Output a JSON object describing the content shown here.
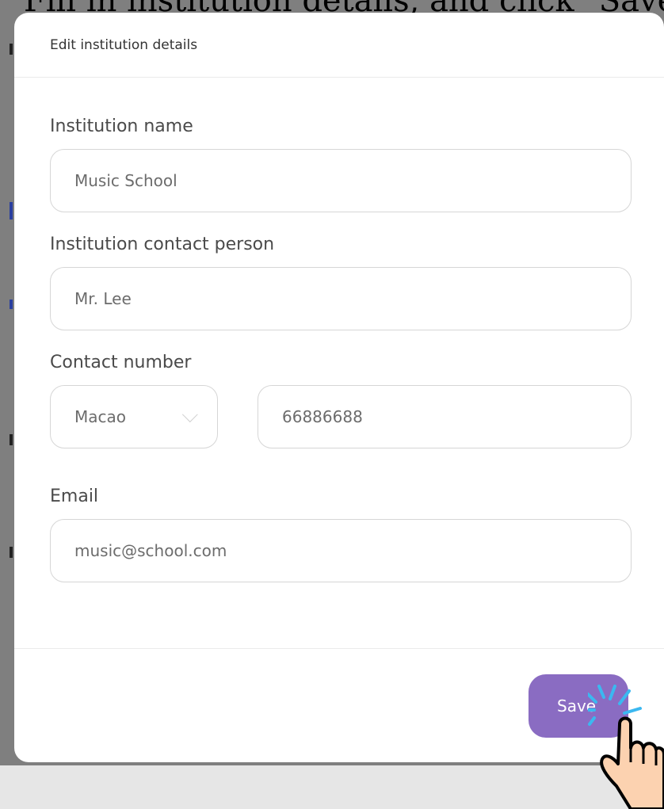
{
  "background": {
    "title_fragment": "Fill in institution details, and click \"Save\""
  },
  "modal": {
    "title": "Edit institution details",
    "fields": {
      "name": {
        "label": "Institution name",
        "value": "Music School"
      },
      "contact_person": {
        "label": "Institution contact person",
        "value": "Mr. Lee"
      },
      "contact_number": {
        "label": "Contact number",
        "region": "Macao",
        "number": "66886688"
      },
      "email": {
        "label": "Email",
        "value": "music@school.com"
      }
    },
    "save_label": "Save"
  },
  "colors": {
    "accent": "#8a6cc2",
    "overlay": "#7f7f7f",
    "click_effect": "#3bb8f0"
  },
  "icons": {
    "select": "chevron-down-icon",
    "pointer": "hand-pointer-icon"
  }
}
